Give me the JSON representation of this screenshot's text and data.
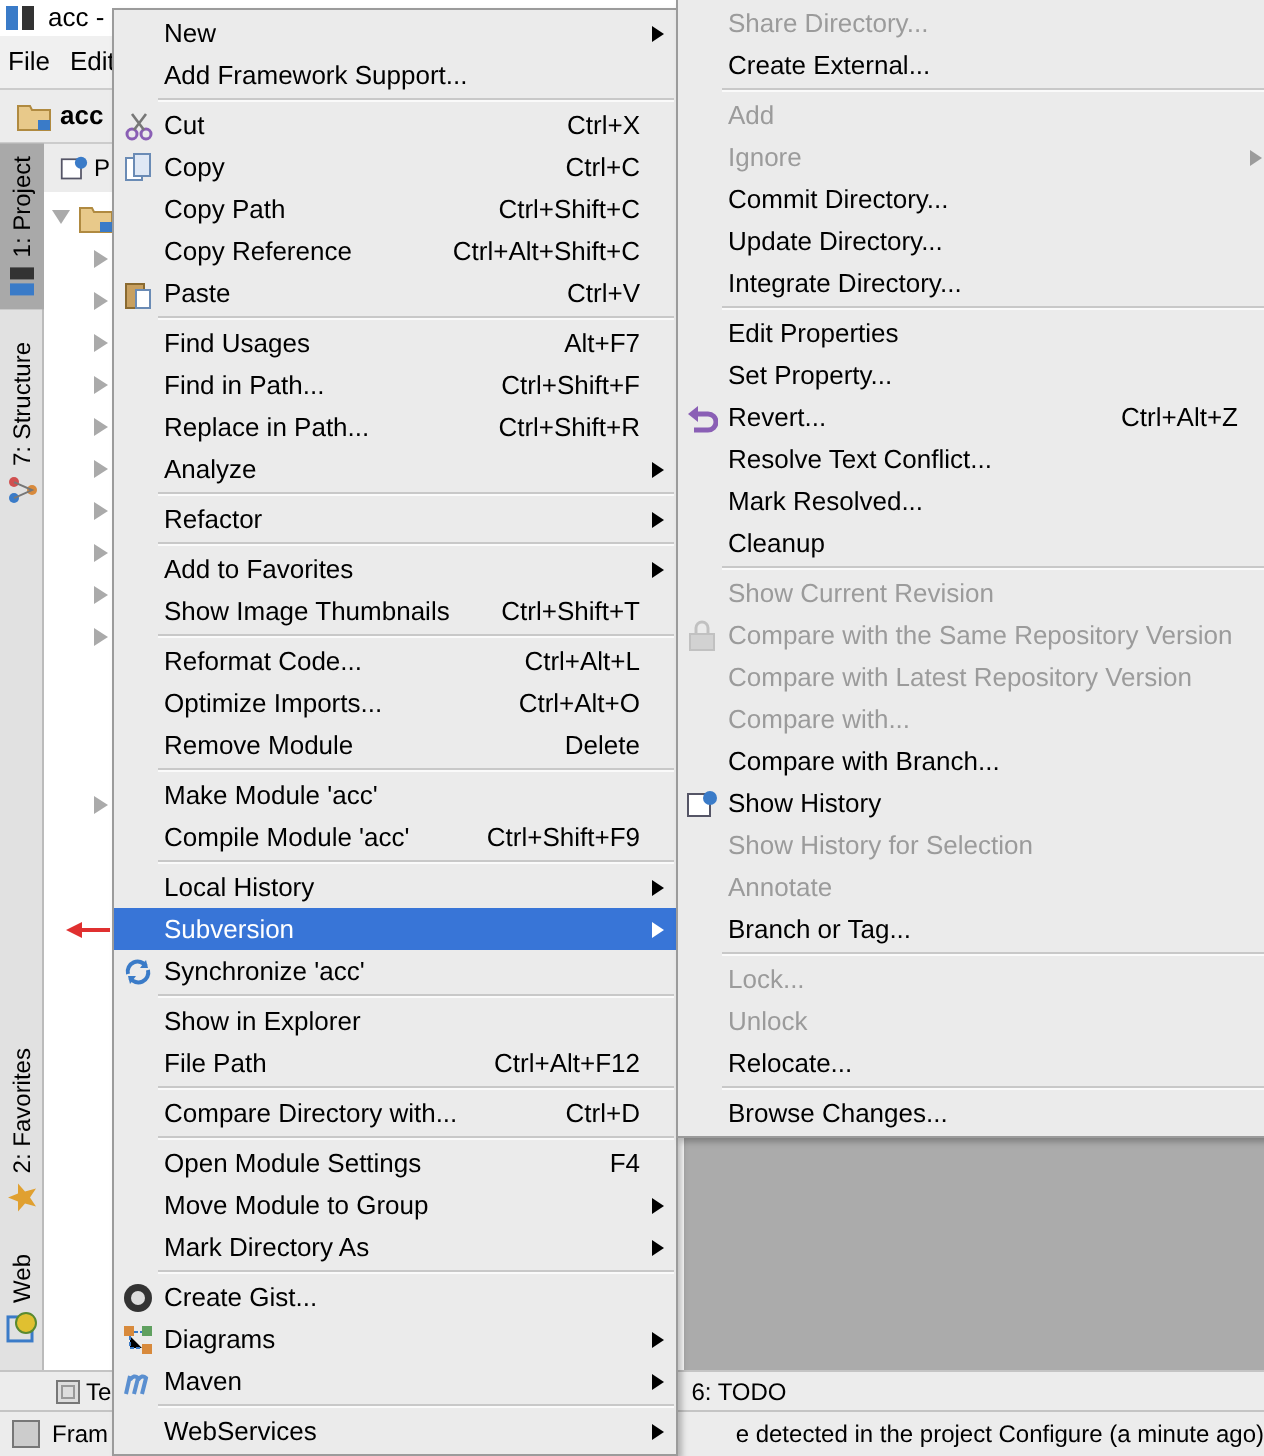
{
  "window": {
    "title": "acc -"
  },
  "menu_bar": [
    "File",
    "Edit"
  ],
  "breadcrumb": "acc",
  "left_tabs": [
    {
      "label": "1: Project",
      "selected": true,
      "kind": "project"
    },
    {
      "label": "7: Structure",
      "selected": false,
      "kind": "structure"
    }
  ],
  "left_tabs_bottom": [
    {
      "label": "2: Favorites",
      "selected": false,
      "kind": "star"
    },
    {
      "label": "Web",
      "selected": false,
      "kind": "web"
    }
  ],
  "project_panel": {
    "header": "P",
    "rows": [
      {
        "kind": "folder",
        "expanded": true
      },
      {
        "kind": "node",
        "expanded": false
      },
      {
        "kind": "node",
        "expanded": false
      },
      {
        "kind": "node",
        "expanded": false
      },
      {
        "kind": "node",
        "expanded": false
      },
      {
        "kind": "node",
        "expanded": false
      },
      {
        "kind": "node",
        "expanded": false
      },
      {
        "kind": "node",
        "expanded": false
      },
      {
        "kind": "node",
        "expanded": false
      },
      {
        "kind": "node",
        "expanded": false
      },
      {
        "kind": "node",
        "expanded": false
      },
      {
        "kind": "library",
        "expanded": false
      }
    ]
  },
  "context_menu": [
    [
      {
        "label": "New",
        "submenu": true
      },
      {
        "label": "Add Framework Support..."
      }
    ],
    [
      {
        "label": "Cut",
        "shortcut": "Ctrl+X",
        "kind": "cut"
      },
      {
        "label": "Copy",
        "shortcut": "Ctrl+C",
        "kind": "copy"
      },
      {
        "label": "Copy Path",
        "shortcut": "Ctrl+Shift+C"
      },
      {
        "label": "Copy Reference",
        "shortcut": "Ctrl+Alt+Shift+C"
      },
      {
        "label": "Paste",
        "shortcut": "Ctrl+V",
        "kind": "paste"
      }
    ],
    [
      {
        "label": "Find Usages",
        "shortcut": "Alt+F7"
      },
      {
        "label": "Find in Path...",
        "shortcut": "Ctrl+Shift+F"
      },
      {
        "label": "Replace in Path...",
        "shortcut": "Ctrl+Shift+R"
      },
      {
        "label": "Analyze",
        "submenu": true
      }
    ],
    [
      {
        "label": "Refactor",
        "submenu": true
      }
    ],
    [
      {
        "label": "Add to Favorites",
        "submenu": true
      },
      {
        "label": "Show Image Thumbnails",
        "shortcut": "Ctrl+Shift+T"
      }
    ],
    [
      {
        "label": "Reformat Code...",
        "shortcut": "Ctrl+Alt+L"
      },
      {
        "label": "Optimize Imports...",
        "shortcut": "Ctrl+Alt+O"
      },
      {
        "label": "Remove Module",
        "shortcut": "Delete"
      }
    ],
    [
      {
        "label": "Make Module 'acc'"
      },
      {
        "label": "Compile Module 'acc'",
        "shortcut": "Ctrl+Shift+F9"
      }
    ],
    [
      {
        "label": "Local History",
        "submenu": true
      },
      {
        "label": "Subversion",
        "submenu": true,
        "selected": true
      },
      {
        "label": "Synchronize 'acc'",
        "kind": "sync"
      }
    ],
    [
      {
        "label": "Show in Explorer"
      },
      {
        "label": "File Path",
        "shortcut": "Ctrl+Alt+F12"
      }
    ],
    [
      {
        "label": "Compare Directory with...",
        "shortcut": "Ctrl+D"
      }
    ],
    [
      {
        "label": "Open Module Settings",
        "shortcut": "F4"
      },
      {
        "label": "Move Module to Group",
        "submenu": true
      },
      {
        "label": "Mark Directory As",
        "submenu": true
      }
    ],
    [
      {
        "label": "Create Gist...",
        "kind": "gist"
      },
      {
        "label": "Diagrams",
        "submenu": true,
        "kind": "diagram"
      },
      {
        "label": "Maven",
        "submenu": true,
        "kind": "maven"
      }
    ],
    [
      {
        "label": "WebServices",
        "submenu": true
      }
    ]
  ],
  "subversion_menu": [
    [
      {
        "label": "Share Directory...",
        "disabled": true
      },
      {
        "label": "Create External..."
      }
    ],
    [
      {
        "label": "Add",
        "disabled": true
      },
      {
        "label": "Ignore",
        "disabled": true,
        "submenu": true
      },
      {
        "label": "Commit Directory..."
      },
      {
        "label": "Update Directory..."
      },
      {
        "label": "Integrate Directory..."
      }
    ],
    [
      {
        "label": "Edit Properties"
      },
      {
        "label": "Set Property..."
      },
      {
        "label": "Revert...",
        "shortcut": "Ctrl+Alt+Z",
        "kind": "revert"
      },
      {
        "label": "Resolve Text Conflict..."
      },
      {
        "label": "Mark Resolved..."
      },
      {
        "label": "Cleanup"
      }
    ],
    [
      {
        "label": "Show Current Revision",
        "disabled": true
      },
      {
        "label": "Compare with the Same Repository Version",
        "disabled": true,
        "kind": "compare"
      },
      {
        "label": "Compare with Latest Repository Version",
        "disabled": true
      },
      {
        "label": "Compare with...",
        "disabled": true
      },
      {
        "label": "Compare with Branch..."
      },
      {
        "label": "Show History",
        "kind": "history"
      },
      {
        "label": "Show History for Selection",
        "disabled": true
      },
      {
        "label": "Annotate",
        "disabled": true
      },
      {
        "label": "Branch or Tag..."
      }
    ],
    [
      {
        "label": "Lock...",
        "disabled": true
      },
      {
        "label": "Unlock",
        "disabled": true
      },
      {
        "label": "Relocate..."
      }
    ],
    [
      {
        "label": "Browse Changes..."
      }
    ]
  ],
  "bottom_tabs": [
    "Te",
    "6: TODO"
  ],
  "status_bar": [
    "Fram",
    "e detected in the project Configure (a minute ago)"
  ]
}
